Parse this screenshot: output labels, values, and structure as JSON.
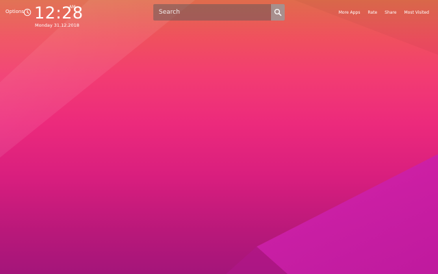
{
  "header": {
    "options_label": "Options",
    "time": "12:28",
    "ampm": "AM",
    "date": "Monday  31.12.2018"
  },
  "search": {
    "placeholder": "Search"
  },
  "nav": {
    "more_apps": "More Apps",
    "rate": "Rate",
    "share": "Share",
    "most_visited": "Most Visited"
  },
  "icons": {
    "clock": "clock-icon",
    "search": "search-icon"
  },
  "colors": {
    "top": "#e06c4c",
    "middle": "#ec2a7c",
    "bottom": "#a4157a",
    "accent_panel": "#d020a8"
  }
}
